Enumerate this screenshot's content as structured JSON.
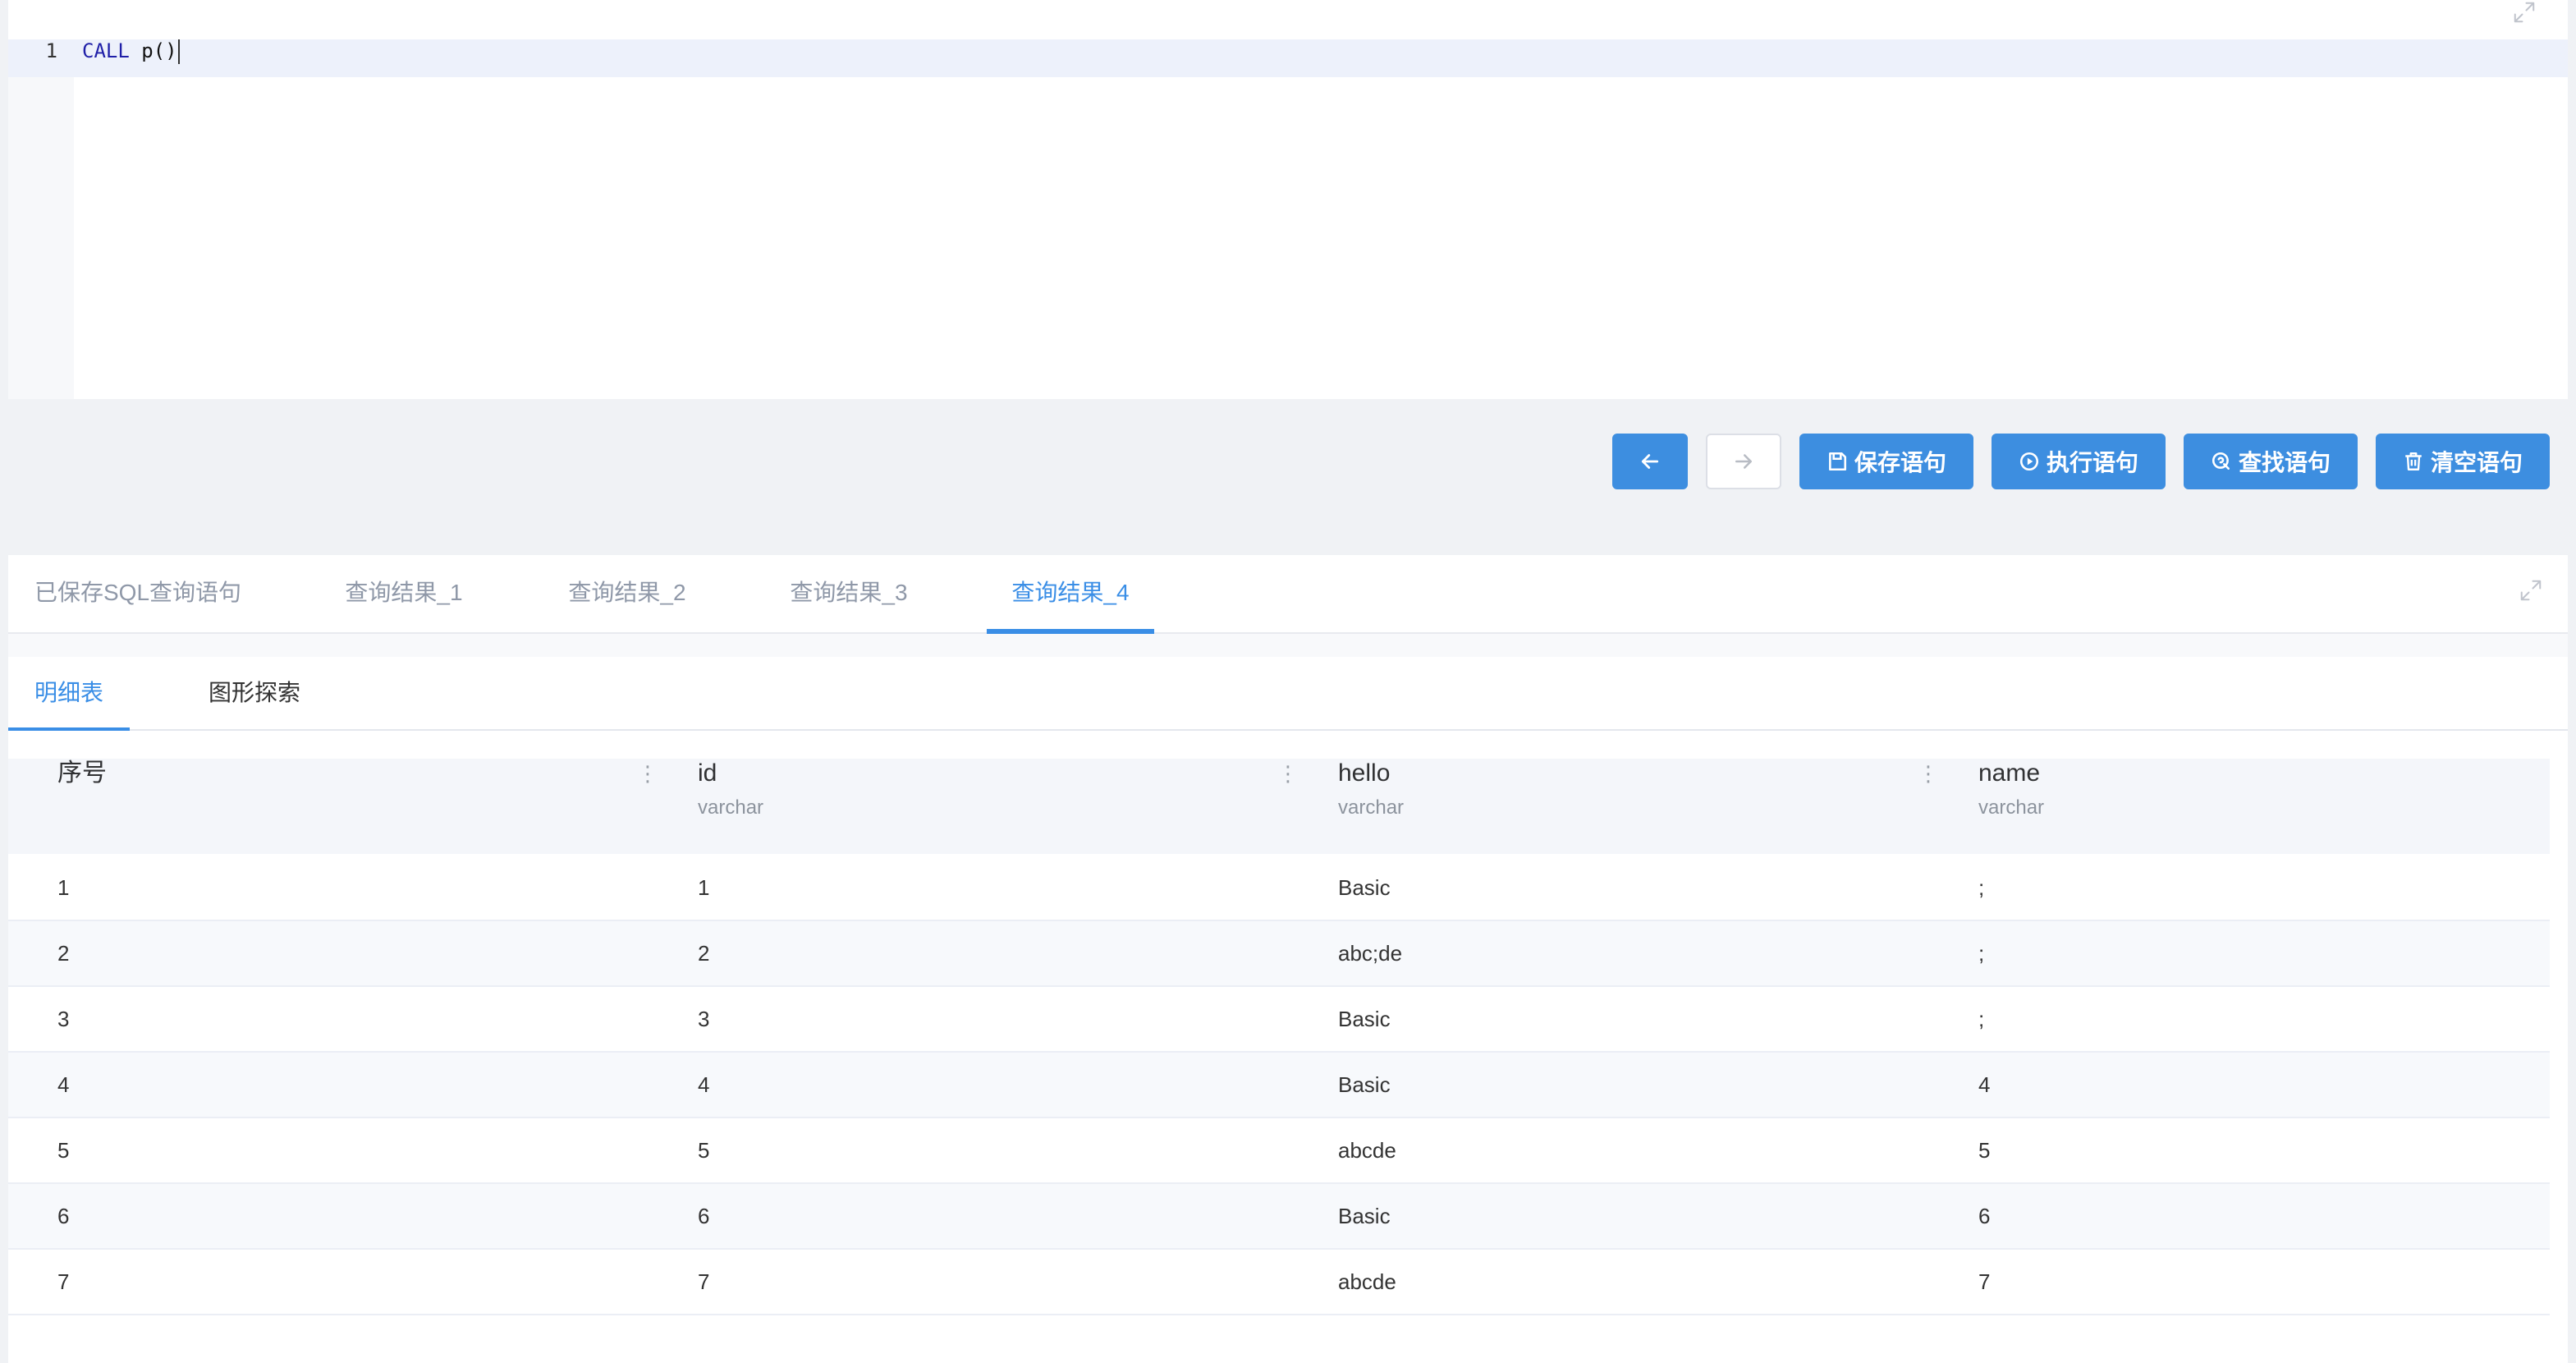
{
  "editor": {
    "line_number": "1",
    "code_keyword": "CALL",
    "code_rest": "p()",
    "expand_icon": "expand-icon"
  },
  "toolbar": {
    "back_icon": "arrow-left-icon",
    "forward_icon": "arrow-right-icon",
    "forward_disabled": true,
    "save_icon": "save-icon",
    "save_label": "保存语句",
    "run_icon": "play-circle-icon",
    "run_label": "执行语句",
    "find_icon": "search-icon",
    "find_label": "查找语句",
    "clear_icon": "trash-icon",
    "clear_label": "清空语句"
  },
  "result_tabs": {
    "items": [
      {
        "label": "已保存SQL查询语句",
        "active": false
      },
      {
        "label": "查询结果_1",
        "active": false
      },
      {
        "label": "查询结果_2",
        "active": false
      },
      {
        "label": "查询结果_3",
        "active": false
      },
      {
        "label": "查询结果_4",
        "active": true
      }
    ],
    "expand_icon": "expand-icon"
  },
  "view_tabs": {
    "items": [
      {
        "label": "明细表",
        "active": true
      },
      {
        "label": "图形探索",
        "active": false
      }
    ]
  },
  "table": {
    "columns": [
      {
        "name": "序号"
      },
      {
        "name": "id",
        "type": "varchar"
      },
      {
        "name": "hello",
        "type": "varchar"
      },
      {
        "name": "name",
        "type": "varchar"
      }
    ],
    "menu_icon": "vertical-dots-icon",
    "rows": [
      [
        "1",
        "1",
        "Basic",
        ";"
      ],
      [
        "2",
        "2",
        "abc;de",
        ";"
      ],
      [
        "3",
        "3",
        "Basic",
        ";"
      ],
      [
        "4",
        "4",
        "Basic",
        "4"
      ],
      [
        "5",
        "5",
        "abcde",
        "5"
      ],
      [
        "6",
        "6",
        "Basic",
        "6"
      ],
      [
        "7",
        "7",
        "abcde",
        "7"
      ]
    ]
  },
  "colors": {
    "accent": "#3a8ee6",
    "button": "#3d8ee0",
    "keyword": "#1f1fa8"
  }
}
